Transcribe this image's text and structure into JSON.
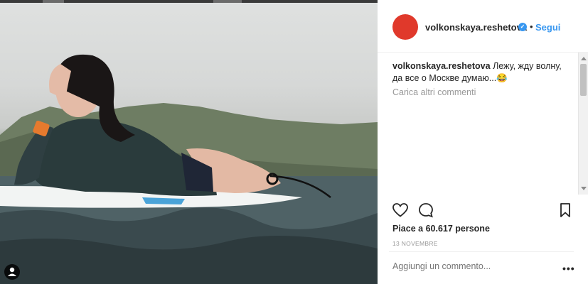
{
  "post": {
    "username": "volkonskaya.reshetova",
    "follow_label": "Segui",
    "separator": "•",
    "caption_username": "volkonskaya.reshetova",
    "caption_text": "Лежу, жду волну, да все о Москве думаю...😂",
    "load_more": "Carica altri commenti",
    "likes": "Piace a 60.617 persone",
    "date": "13 NOVEMBRE",
    "comment_placeholder": "Aggiungi un commento...",
    "more_label": "•••"
  },
  "icons": {
    "like": "heart-icon",
    "comment": "comment-icon",
    "save": "bookmark-icon",
    "verified": "verified-badge-icon",
    "tag": "user-tag-icon"
  },
  "colors": {
    "avatar": "#e0392b",
    "link": "#3897f0",
    "text": "#262626",
    "muted": "#999999"
  }
}
